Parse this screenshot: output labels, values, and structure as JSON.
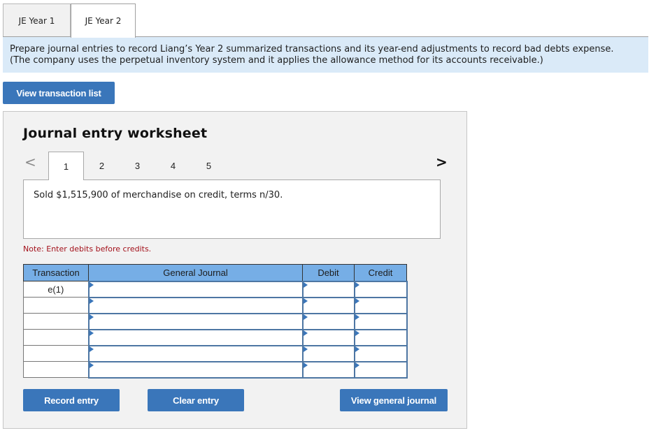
{
  "tabs": [
    {
      "label": "JE Year 1",
      "active": false
    },
    {
      "label": "JE Year 2",
      "active": true
    }
  ],
  "instructions": {
    "line1": "Prepare journal entries to record Liang’s Year 2 summarized transactions and its year-end adjustments to record bad debts expense.",
    "line2": "(The company uses the perpetual inventory system and it applies the allowance method for its accounts receivable.)"
  },
  "buttons": {
    "view_transaction_list": "View transaction list",
    "record_entry": "Record entry",
    "clear_entry": "Clear entry",
    "view_general_journal": "View general journal"
  },
  "worksheet": {
    "title": "Journal entry worksheet",
    "nav_prev_icon": "chevron-left-icon",
    "nav_next_icon": "chevron-right-icon",
    "prev_glyph": "<",
    "next_glyph": ">",
    "steps": [
      {
        "label": "1",
        "active": true
      },
      {
        "label": "2",
        "active": false
      },
      {
        "label": "3",
        "active": false
      },
      {
        "label": "4",
        "active": false
      },
      {
        "label": "5",
        "active": false
      }
    ],
    "description": "Sold $1,515,900 of merchandise on credit, terms n/30.",
    "note": "Note: Enter debits before credits."
  },
  "journal": {
    "headers": {
      "transaction": "Transaction",
      "general_journal": "General Journal",
      "debit": "Debit",
      "credit": "Credit"
    },
    "rows": [
      {
        "transaction": "e(1)",
        "account": "",
        "debit": "",
        "credit": ""
      },
      {
        "transaction": "",
        "account": "",
        "debit": "",
        "credit": ""
      },
      {
        "transaction": "",
        "account": "",
        "debit": "",
        "credit": ""
      },
      {
        "transaction": "",
        "account": "",
        "debit": "",
        "credit": ""
      },
      {
        "transaction": "",
        "account": "",
        "debit": "",
        "credit": ""
      },
      {
        "transaction": "",
        "account": "",
        "debit": "",
        "credit": ""
      }
    ]
  },
  "colors": {
    "accent_button": "#3a76ba",
    "table_header": "#76aee6",
    "banner_bg": "#daeaf8",
    "note_text": "#a3101a",
    "cell_border": "#4d76a3"
  }
}
